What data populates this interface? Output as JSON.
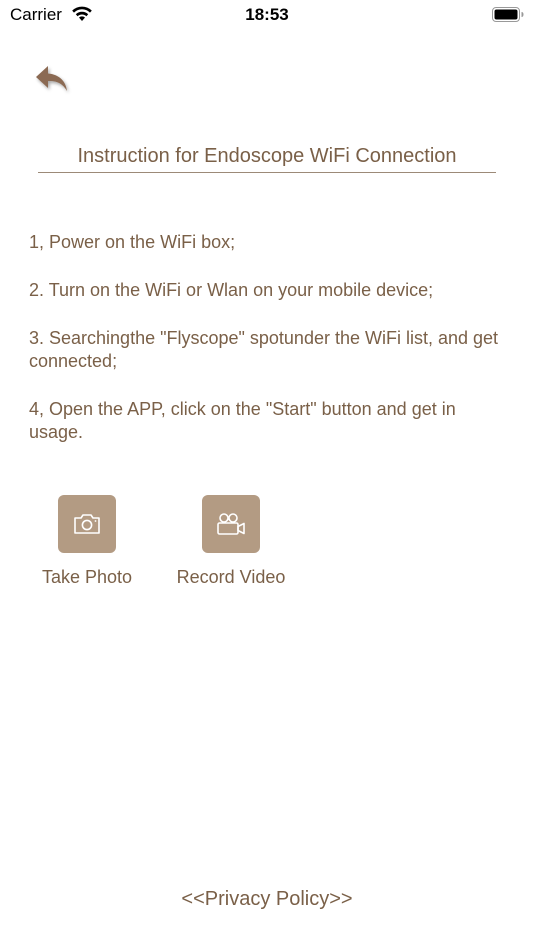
{
  "status_bar": {
    "carrier": "Carrier",
    "time": "18:53"
  },
  "header": {
    "back_icon": "back-arrow-icon",
    "title": "Instruction for Endoscope WiFi Connection"
  },
  "instructions": [
    "1, Power on the WiFi box;",
    "2. Turn on the WiFi or Wlan on your mobile device;",
    "3. Searchingthe \"Flyscope\" spotunder the WiFi list, and get connected;",
    "4, Open the APP, click on the \"Start\" button and get in usage."
  ],
  "actions": {
    "take_photo": {
      "label": "Take Photo",
      "icon": "camera-icon"
    },
    "record_video": {
      "label": "Record Video",
      "icon": "video-camera-icon"
    }
  },
  "footer": {
    "privacy_label": "<<Privacy Policy>>"
  },
  "colors": {
    "text": "#7a6048",
    "tile": "#b39b83",
    "divider": "#9c8a78"
  }
}
